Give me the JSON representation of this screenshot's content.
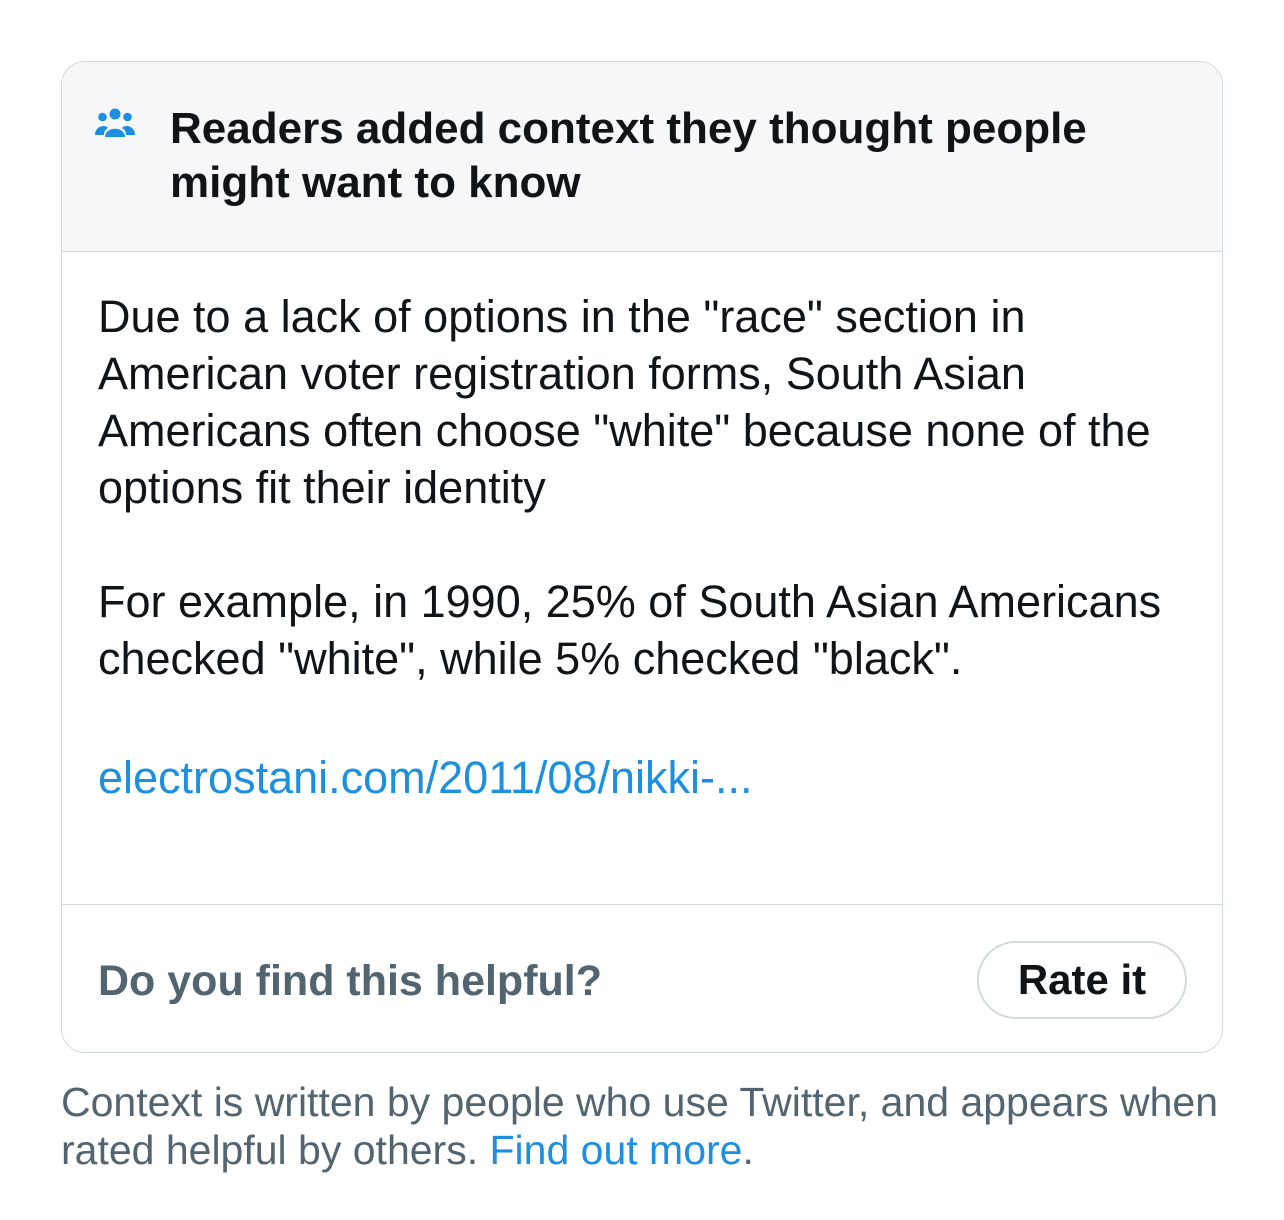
{
  "colors": {
    "accent": "#1d8fe0",
    "text_primary": "#0f1419",
    "text_secondary": "#536471",
    "header_bg": "#f6f7f9",
    "border": "#cfd9de"
  },
  "note": {
    "header": {
      "icon": "people-icon",
      "title": "Readers added context they thought people might want to know"
    },
    "body": {
      "paragraph_1": "Due to a lack of options in the \"race\" section in American voter registration forms, South Asian Americans often choose \"white\" because none of the options fit their identity",
      "paragraph_2": "For example, in 1990, 25% of South Asian Americans checked \"white\", while 5% checked \"black\".",
      "source_link": "electrostani.com/2011/08/nikki-..."
    },
    "footer": {
      "question": "Do you find this helpful?",
      "rate_button_label": "Rate it"
    }
  },
  "disclaimer": {
    "text": "Context is written by people who use Twitter, and appears when rated helpful by others.",
    "link_label": "Find out more",
    "trailing": "."
  }
}
